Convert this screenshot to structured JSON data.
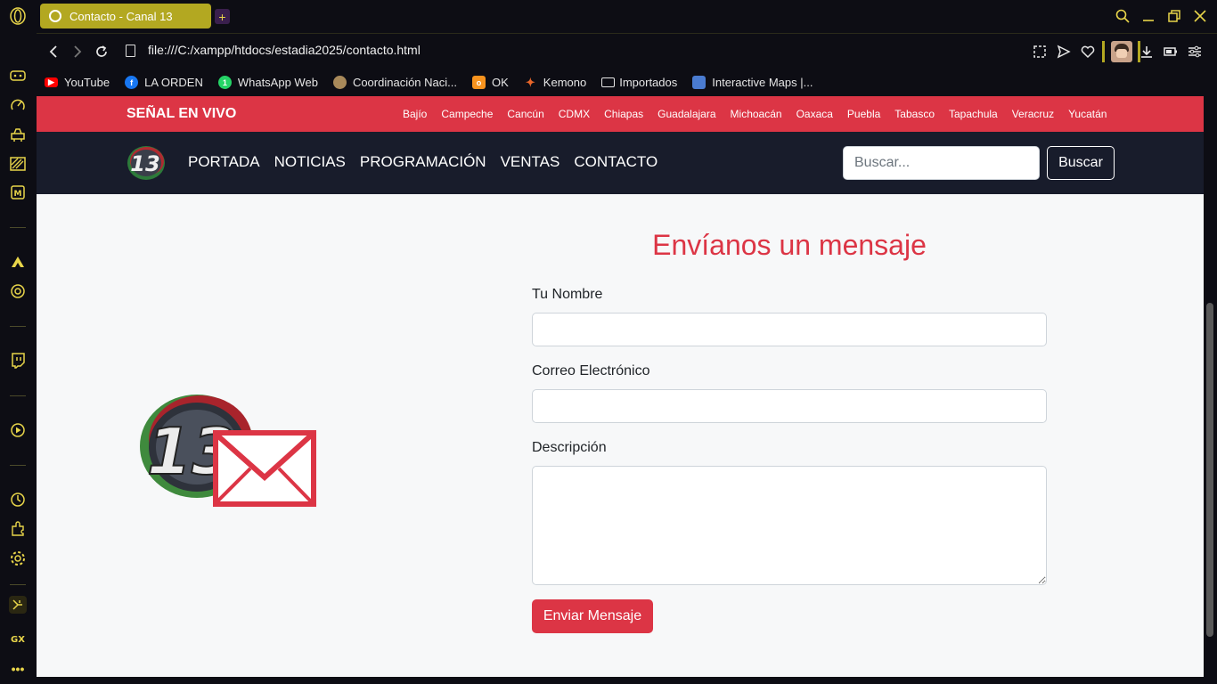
{
  "browser": {
    "tab_title": "Contacto - Canal 13",
    "new_tab_icon": "+",
    "url": "file:///C:/xampp/htdocs/estadia2025/contacto.html",
    "accent_color": "#e8d54a"
  },
  "bookmarks": [
    {
      "label": "YouTube",
      "icon": "youtube-icon",
      "color": "#ff0000"
    },
    {
      "label": "LA ORDEN",
      "icon": "facebook-icon",
      "color": "#1877f2"
    },
    {
      "label": "WhatsApp Web",
      "icon": "whatsapp-icon",
      "color": "#25d366"
    },
    {
      "label": "Coordinación Naci...",
      "icon": "seal-icon",
      "color": "#a8895a"
    },
    {
      "label": "OK",
      "icon": "ok-icon",
      "color": "#f7931e"
    },
    {
      "label": "Kemono",
      "icon": "kemono-icon",
      "color": "#e8662a"
    },
    {
      "label": "Importados",
      "icon": "folder-icon",
      "color": "#e6e6e6"
    },
    {
      "label": "Interactive Maps |...",
      "icon": "maps-icon",
      "color": "#4a7bd0"
    }
  ],
  "site": {
    "live_label": "SEÑAL EN VIVO",
    "cities": [
      "Bajío",
      "Campeche",
      "Cancún",
      "CDMX",
      "Chiapas",
      "Guadalajara",
      "Michoacán",
      "Oaxaca",
      "Puebla",
      "Tabasco",
      "Tapachula",
      "Veracruz",
      "Yucatán"
    ],
    "logo_text": "13",
    "menu": [
      "PORTADA",
      "NOTICIAS",
      "PROGRAMACIÓN",
      "VENTAS",
      "CONTACTO"
    ],
    "search_placeholder": "Buscar...",
    "search_button": "Buscar",
    "brand_color": "#dc3545",
    "nav_color": "#181c2b"
  },
  "form": {
    "title": "Envíanos un mensaje",
    "name_label": "Tu Nombre",
    "name_value": "",
    "email_label": "Correo Electrónico",
    "email_value": "",
    "description_label": "Descripción",
    "description_value": "",
    "submit_label": "Enviar Mensaje"
  }
}
